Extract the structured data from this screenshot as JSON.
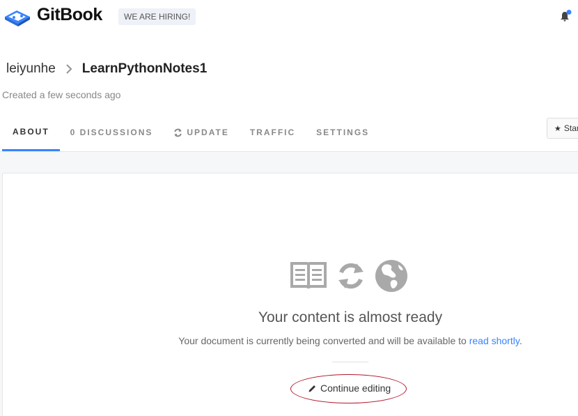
{
  "header": {
    "brand": "GitBook",
    "hiring_badge": "WE ARE HIRING!",
    "logo_icon": "book-icon",
    "notification_icon": "bell-icon",
    "notification_dot_color": "#3884ff"
  },
  "breadcrumb": {
    "user": "leiyunhe",
    "separator_icon": "chevron-right-icon",
    "book": "LearnPythonNotes1"
  },
  "meta": {
    "created": "Created a few seconds ago"
  },
  "tabs": [
    {
      "label": "ABOUT",
      "active": true
    },
    {
      "label": "0 DISCUSSIONS",
      "active": false
    },
    {
      "label": "UPDATE",
      "active": false,
      "icon": "refresh-icon"
    },
    {
      "label": "TRAFFIC",
      "active": false
    },
    {
      "label": "SETTINGS",
      "active": false
    }
  ],
  "star_button": {
    "label": "Star",
    "icon": "star-icon"
  },
  "status": {
    "icons": [
      "open-book-icon",
      "refresh-icon",
      "globe-icon"
    ],
    "title": "Your content is almost ready",
    "description": "Your document is currently being converted and will be available to",
    "link_text": "read shortly",
    "trailing": ".",
    "continue_label": "Continue editing",
    "continue_icon": "pencil-icon"
  },
  "colors": {
    "accent": "#3884ff",
    "annotation": "#b0162b"
  }
}
